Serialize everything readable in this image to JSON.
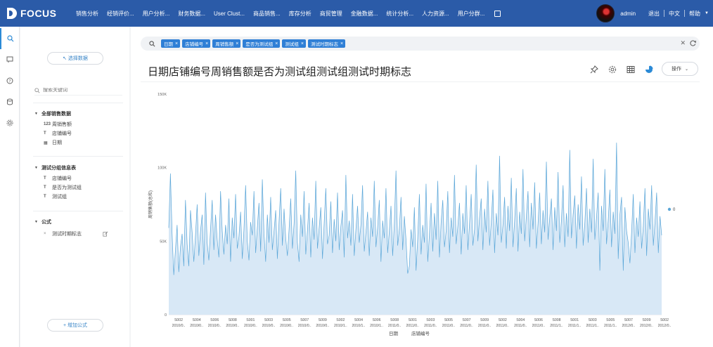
{
  "app": {
    "brand": "FOCUS"
  },
  "nav": {
    "items": [
      "销售分析",
      "经销评价...",
      "用户分析...",
      "财务数据...",
      "User Clust...",
      "商品销售...",
      "库存分析",
      "商贸管理",
      "金融数据...",
      "统计分析...",
      "人力资源...",
      "用户分群..."
    ],
    "user": "admin",
    "logout": "退出",
    "language": "中文",
    "help": "帮助"
  },
  "rail": {
    "icons": [
      "search-icon",
      "comment-icon",
      "help-icon",
      "database-icon",
      "settings-icon"
    ]
  },
  "sidebar": {
    "select_data": "↖ 选择数据",
    "search_placeholder": "搜索关键词",
    "groups": [
      {
        "title": "全部销售数据",
        "fields": [
          {
            "icon": "123",
            "label": "周销售额"
          },
          {
            "icon": "T",
            "label": "店铺编号"
          },
          {
            "icon": "cal",
            "label": "日期"
          }
        ]
      },
      {
        "title": "测试分组信息表",
        "fields": [
          {
            "icon": "T",
            "label": "店铺编号"
          },
          {
            "icon": "T",
            "label": "是否为测试组"
          },
          {
            "icon": "T",
            "label": "测试组"
          }
        ]
      },
      {
        "title": "公式",
        "fields": [
          {
            "icon": "×",
            "label": "测试时期标志"
          }
        ]
      }
    ],
    "add_formula": "+ 增加公式"
  },
  "filter": {
    "tags": [
      "日期",
      "店铺编号",
      "周销售额",
      "是否为测试组",
      "测试组",
      "测试时期标志"
    ]
  },
  "main": {
    "title": "日期店铺编号周销售额是否为测试组测试组测试时期标志",
    "operate": "操作"
  },
  "chart_data": {
    "type": "area",
    "ylabel": "周销售额(总和)",
    "xlabel": "日期",
    "xlabel2": "店铺编号",
    "yticks": [
      "0",
      "50K",
      "100K",
      "150K"
    ],
    "ylim": [
      0,
      150000
    ],
    "legend": [
      "0"
    ],
    "color": "#5aa6d8",
    "fill": "#d8e8f6",
    "x_store_labels": [
      "S002",
      "S004",
      "S006",
      "S008",
      "S001",
      "S003",
      "S005",
      "S007",
      "S009",
      "S002",
      "S004",
      "S006",
      "S008",
      "S001",
      "S003",
      "S005",
      "S007",
      "S009",
      "S002",
      "S004",
      "S006",
      "S008",
      "S001",
      "S003",
      "S005",
      "S007",
      "S009",
      "S002"
    ],
    "x_date_labels": [
      "2010/0..",
      "2010/0..",
      "2010/0..",
      "2010/0..",
      "2010/0..",
      "2010/0..",
      "2010/0..",
      "2010/0..",
      "2010/0..",
      "2010/1..",
      "2010/1..",
      "2010/1..",
      "2011/0..",
      "2011/0..",
      "2011/0..",
      "2011/0..",
      "2011/0..",
      "2011/0..",
      "2011/0..",
      "2011/0..",
      "2011/0..",
      "2011/1..",
      "2011/1..",
      "2011/1..",
      "2011/1..",
      "2012/0..",
      "2012/0..",
      "2012/0.."
    ],
    "values": [
      59000,
      96000,
      55000,
      27000,
      44000,
      61000,
      29000,
      46000,
      55000,
      33000,
      78000,
      48000,
      33000,
      71000,
      56000,
      36000,
      54000,
      75000,
      40000,
      57000,
      68000,
      34000,
      83000,
      49000,
      37000,
      58000,
      78000,
      44000,
      68000,
      51000,
      39000,
      84000,
      57000,
      41000,
      61000,
      48000,
      79000,
      36000,
      66000,
      52000,
      82000,
      45000,
      53000,
      70000,
      38000,
      58000,
      88000,
      50000,
      37000,
      63000,
      54000,
      84000,
      42000,
      59000,
      76000,
      43000,
      92000,
      55000,
      36000,
      68000,
      49000,
      80000,
      44000,
      57000,
      71000,
      38000,
      63000,
      86000,
      47000,
      72000,
      52000,
      40000,
      58000,
      79000,
      45000,
      62000,
      98000,
      49000,
      36000,
      68000,
      53000,
      84000,
      41000,
      57000,
      76000,
      39000,
      66000,
      51000,
      91000,
      45000,
      59000,
      73000,
      38000,
      62000,
      86000,
      48000,
      54000,
      77000,
      42000,
      65000,
      50000,
      83000,
      44000,
      60000,
      71000,
      39000,
      95000,
      52000,
      64000,
      47000,
      82000,
      40000,
      58000,
      74000,
      49000,
      61000,
      88000,
      43000,
      56000,
      70000,
      40000,
      66000,
      53000,
      91000,
      46000,
      59000,
      78000,
      36000,
      64000,
      52000,
      86000,
      42000,
      57000,
      74000,
      40000,
      62000,
      98000,
      47000,
      58000,
      80000,
      44000,
      67000,
      51000,
      28000,
      33000,
      58000,
      46000,
      73000,
      30000,
      52000,
      82000,
      41000,
      61000,
      49000,
      89000,
      36000,
      55000,
      76000,
      43000,
      69000,
      51000,
      91000,
      39000,
      63000,
      78000,
      46000,
      57000,
      84000,
      42000,
      66000,
      53000,
      95000,
      48000,
      60000,
      76000,
      41000,
      69000,
      55000,
      88000,
      44000,
      62000,
      82000,
      47000,
      58000,
      102000,
      50000,
      66000,
      79000,
      44000,
      72000,
      56000,
      91000,
      47000,
      63000,
      85000,
      42000,
      69000,
      54000,
      108000,
      49000,
      61000,
      80000,
      45000,
      74000,
      57000,
      93000,
      46000,
      64000,
      86000,
      43000,
      70000,
      55000,
      99000,
      50000,
      67000,
      84000,
      46000,
      76000,
      58000,
      90000,
      45000,
      62000,
      83000,
      48000,
      71000,
      56000,
      104000,
      51000,
      66000,
      79000,
      44000,
      73000,
      57000,
      97000,
      49000,
      64000,
      88000,
      46000,
      69000,
      53000,
      112000,
      52000,
      68000,
      81000,
      45000,
      75000,
      58000,
      94000,
      47000,
      62000,
      86000,
      49000,
      72000,
      56000,
      106000,
      51000,
      66000,
      83000,
      30000,
      74000,
      57000,
      99000,
      48000,
      64000,
      85000,
      46000,
      70000,
      55000,
      117000,
      38000,
      68000,
      80000,
      30000,
      73000,
      57000,
      49000,
      35000,
      56000,
      82000,
      42000,
      66000,
      53000,
      77000,
      45000,
      60000,
      86000,
      40000,
      72000,
      58000,
      88000,
      47000,
      63000,
      83000,
      42000,
      67000,
      54000
    ]
  }
}
